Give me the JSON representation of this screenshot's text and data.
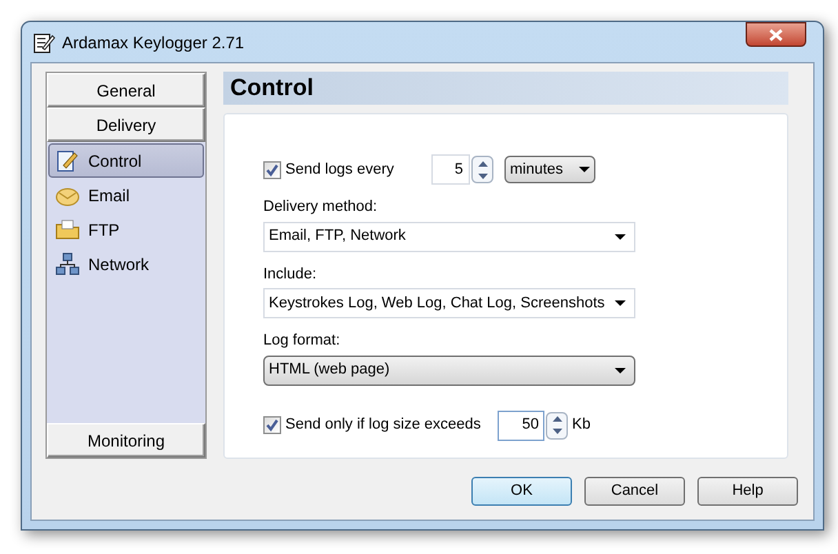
{
  "window": {
    "title": "Ardamax Keylogger 2.71"
  },
  "sidebar": {
    "top_groups": [
      {
        "label": "General"
      },
      {
        "label": "Delivery"
      }
    ],
    "items": [
      {
        "label": "Control",
        "selected": true
      },
      {
        "label": "Email",
        "selected": false
      },
      {
        "label": "FTP",
        "selected": false
      },
      {
        "label": "Network",
        "selected": false
      }
    ],
    "bottom_groups": [
      {
        "label": "Monitoring"
      }
    ]
  },
  "panel": {
    "title": "Control",
    "send_logs": {
      "checked": true,
      "label": "Send logs every",
      "value": "5",
      "unit": "minutes"
    },
    "delivery_method": {
      "label": "Delivery method:",
      "value": "Email, FTP, Network"
    },
    "include": {
      "label": "Include:",
      "value": "Keystrokes Log, Web Log, Chat Log, Screenshots"
    },
    "log_format": {
      "label": "Log format:",
      "value": "HTML (web page)"
    },
    "size_limit": {
      "checked": true,
      "label": "Send only if log size exceeds",
      "value": "50",
      "unit": "Kb"
    }
  },
  "buttons": [
    {
      "label": "OK",
      "default": true
    },
    {
      "label": "Cancel",
      "default": false
    },
    {
      "label": "Help",
      "default": false
    }
  ]
}
